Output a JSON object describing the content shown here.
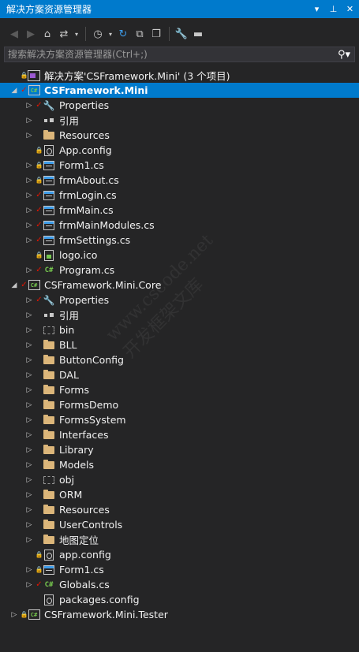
{
  "window": {
    "title": "解决方案资源管理器",
    "buttons": [
      "dropdown-icon",
      "pin-icon",
      "close-icon"
    ]
  },
  "search": {
    "placeholder": "搜索解决方案资源管理器(Ctrl+;)"
  },
  "toolbar": {
    "items": [
      "back-icon",
      "forward-icon",
      "home-icon",
      "sync-view-icon",
      "pending-changes-icon",
      "refresh-icon",
      "collapse-all-icon",
      "show-all-files-icon",
      "properties-icon",
      "preview-icon"
    ]
  },
  "colors": {
    "accent": "#007acc",
    "background": "#252526",
    "folder": "#dcb67a",
    "check": "#e51400",
    "csharp": "#76c74e"
  },
  "tree": [
    {
      "label": "解决方案'CSFramework.Mini' (3 个项目)",
      "indent": 0,
      "expander": "",
      "status": "lock",
      "icon": "solution-icon"
    },
    {
      "label": "CSFramework.Mini",
      "indent": 0,
      "expander": "expanded",
      "status": "check",
      "icon": "csharp-project-icon",
      "selected": true
    },
    {
      "label": "Properties",
      "indent": 1,
      "expander": "collapsed",
      "status": "check",
      "icon": "wrench-icon"
    },
    {
      "label": "引用",
      "indent": 1,
      "expander": "collapsed",
      "status": "",
      "icon": "references-icon"
    },
    {
      "label": "Resources",
      "indent": 1,
      "expander": "collapsed",
      "status": "",
      "icon": "folder-icon"
    },
    {
      "label": "App.config",
      "indent": 1,
      "expander": "",
      "status": "lock",
      "icon": "config-file-icon"
    },
    {
      "label": "Form1.cs",
      "indent": 1,
      "expander": "collapsed",
      "status": "lock",
      "icon": "form-icon"
    },
    {
      "label": "frmAbout.cs",
      "indent": 1,
      "expander": "collapsed",
      "status": "lock",
      "icon": "form-icon"
    },
    {
      "label": "frmLogin.cs",
      "indent": 1,
      "expander": "collapsed",
      "status": "check",
      "icon": "form-icon"
    },
    {
      "label": "frmMain.cs",
      "indent": 1,
      "expander": "collapsed",
      "status": "check",
      "icon": "form-icon"
    },
    {
      "label": "frmMainModules.cs",
      "indent": 1,
      "expander": "collapsed",
      "status": "check",
      "icon": "form-icon"
    },
    {
      "label": "frmSettings.cs",
      "indent": 1,
      "expander": "collapsed",
      "status": "check",
      "icon": "form-icon"
    },
    {
      "label": "logo.ico",
      "indent": 1,
      "expander": "",
      "status": "lock",
      "icon": "image-file-icon"
    },
    {
      "label": "Program.cs",
      "indent": 1,
      "expander": "collapsed",
      "status": "check",
      "icon": "csharp-file-icon"
    },
    {
      "label": "CSFramework.Mini.Core",
      "indent": 0,
      "expander": "expanded",
      "status": "check",
      "icon": "csharp-project-icon"
    },
    {
      "label": "Properties",
      "indent": 1,
      "expander": "collapsed",
      "status": "check",
      "icon": "wrench-icon"
    },
    {
      "label": "引用",
      "indent": 1,
      "expander": "collapsed",
      "status": "",
      "icon": "references-icon"
    },
    {
      "label": "bin",
      "indent": 1,
      "expander": "collapsed",
      "status": "",
      "icon": "dotted-folder-icon"
    },
    {
      "label": "BLL",
      "indent": 1,
      "expander": "collapsed",
      "status": "",
      "icon": "folder-icon"
    },
    {
      "label": "ButtonConfig",
      "indent": 1,
      "expander": "collapsed",
      "status": "",
      "icon": "folder-icon"
    },
    {
      "label": "DAL",
      "indent": 1,
      "expander": "collapsed",
      "status": "",
      "icon": "folder-icon"
    },
    {
      "label": "Forms",
      "indent": 1,
      "expander": "collapsed",
      "status": "",
      "icon": "folder-icon"
    },
    {
      "label": "FormsDemo",
      "indent": 1,
      "expander": "collapsed",
      "status": "",
      "icon": "folder-icon"
    },
    {
      "label": "FormsSystem",
      "indent": 1,
      "expander": "collapsed",
      "status": "",
      "icon": "folder-icon"
    },
    {
      "label": "Interfaces",
      "indent": 1,
      "expander": "collapsed",
      "status": "",
      "icon": "folder-icon"
    },
    {
      "label": "Library",
      "indent": 1,
      "expander": "collapsed",
      "status": "",
      "icon": "folder-icon"
    },
    {
      "label": "Models",
      "indent": 1,
      "expander": "collapsed",
      "status": "",
      "icon": "folder-icon"
    },
    {
      "label": "obj",
      "indent": 1,
      "expander": "collapsed",
      "status": "",
      "icon": "dotted-folder-icon"
    },
    {
      "label": "ORM",
      "indent": 1,
      "expander": "collapsed",
      "status": "",
      "icon": "folder-icon"
    },
    {
      "label": "Resources",
      "indent": 1,
      "expander": "collapsed",
      "status": "",
      "icon": "folder-icon"
    },
    {
      "label": "UserControls",
      "indent": 1,
      "expander": "collapsed",
      "status": "",
      "icon": "folder-icon"
    },
    {
      "label": "地图定位",
      "indent": 1,
      "expander": "collapsed",
      "status": "",
      "icon": "folder-icon"
    },
    {
      "label": "app.config",
      "indent": 1,
      "expander": "",
      "status": "lock",
      "icon": "config-file-icon"
    },
    {
      "label": "Form1.cs",
      "indent": 1,
      "expander": "collapsed",
      "status": "lock",
      "icon": "form-icon"
    },
    {
      "label": "Globals.cs",
      "indent": 1,
      "expander": "collapsed",
      "status": "check",
      "icon": "csharp-file-icon"
    },
    {
      "label": "packages.config",
      "indent": 1,
      "expander": "",
      "status": "",
      "icon": "config-file-icon"
    },
    {
      "label": "CSFramework.Mini.Tester",
      "indent": 0,
      "expander": "collapsed",
      "status": "lock",
      "icon": "csharp-project-icon"
    }
  ],
  "watermark": {
    "line1": "www.cscode.net",
    "line2": "开发框架文库"
  }
}
